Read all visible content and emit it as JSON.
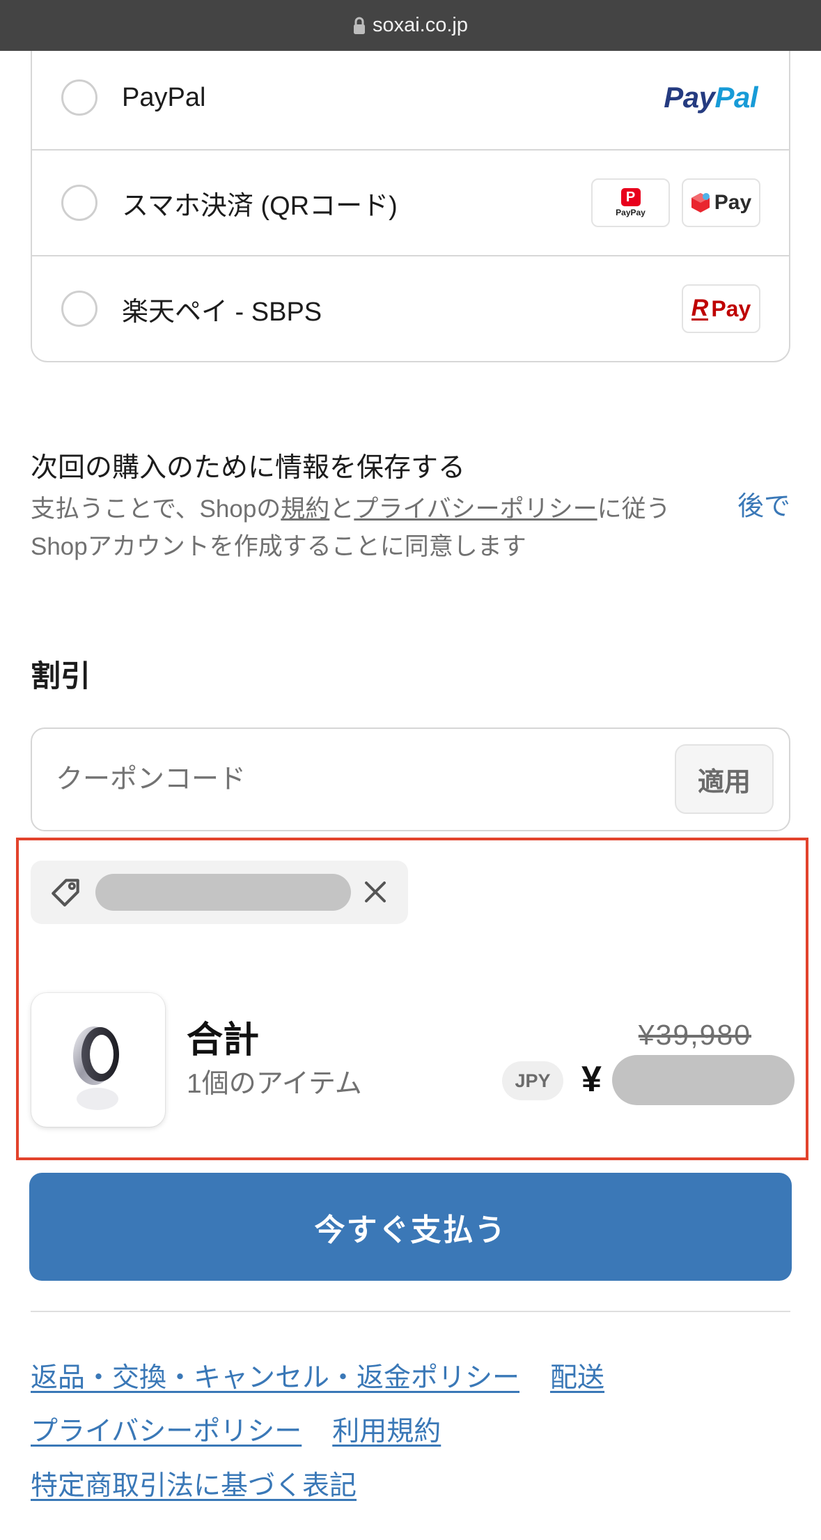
{
  "browser": {
    "url": "soxai.co.jp",
    "lock_icon": "lock-icon"
  },
  "payment_methods": {
    "paypal": {
      "label": "PayPal",
      "logo_part1": "Pay",
      "logo_part2": "Pal"
    },
    "qr": {
      "label": "スマホ決済 (QRコード)",
      "paypay_mark": "P",
      "paypay_text": "PayPay",
      "merpay_text": "Pay"
    },
    "rakuten": {
      "label": "楽天ペイ - SBPS",
      "logo_r": "R",
      "logo_pay": "Pay"
    }
  },
  "save_info": {
    "title": "次回の購入のために情報を保存する",
    "line1_prefix": "支払うことで、Shopの",
    "terms_link": "規約",
    "connector": "と",
    "privacy_link": "プライバシーポリシー",
    "line1_suffix": "に従う",
    "line2": "Shopアカウントを作成することに同意します",
    "later_label": "後で"
  },
  "discount": {
    "heading": "割引",
    "placeholder": "クーポンコード",
    "apply_label": "適用"
  },
  "summary": {
    "label": "合計",
    "item_count": "1個のアイテム",
    "original_price": "¥39,980",
    "currency": "JPY",
    "currency_symbol": "¥"
  },
  "pay_button": {
    "label": "今すぐ支払う"
  },
  "footer": {
    "rows": [
      [
        "返品・交換・キャンセル・返金ポリシー",
        "配送"
      ],
      [
        "プライバシーポリシー",
        "利用規約"
      ],
      [
        "特定商取引法に基づく表記"
      ]
    ]
  },
  "colors": {
    "accent": "#3b78b7",
    "highlight": "#e2432c",
    "paypal_dark": "#253b80",
    "paypal_light": "#179bd7",
    "rakuten_red": "#bf0000",
    "redaction": "#c4c4c4"
  },
  "icons": [
    "lock-icon",
    "tag-icon",
    "close-icon",
    "ring-product-image"
  ]
}
